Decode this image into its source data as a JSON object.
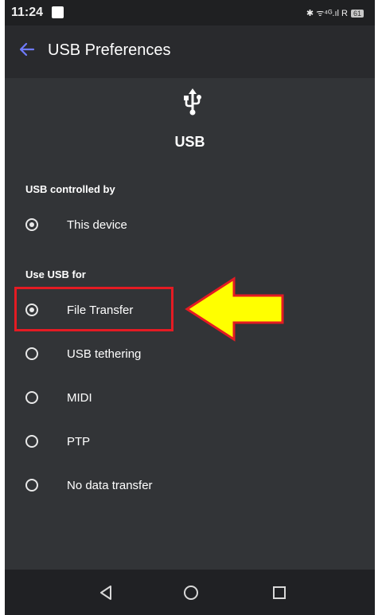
{
  "status_bar": {
    "time": "11:24",
    "indicators": "✱ ᯤ⁴ᴳ.ıl R",
    "battery": "61"
  },
  "app_bar": {
    "back_icon": "arrow-left-icon",
    "title": "USB Preferences"
  },
  "header": {
    "icon": "usb-icon",
    "label": "USB"
  },
  "sections": {
    "controlled_by": {
      "title": "USB controlled by",
      "options": [
        {
          "label": "This device",
          "selected": true
        }
      ]
    },
    "use_for": {
      "title": "Use USB for",
      "options": [
        {
          "label": "File Transfer",
          "selected": true
        },
        {
          "label": "USB tethering",
          "selected": false
        },
        {
          "label": "MIDI",
          "selected": false
        },
        {
          "label": "PTP",
          "selected": false
        },
        {
          "label": "No data transfer",
          "selected": false
        }
      ]
    }
  },
  "annotation": {
    "highlight_color": "#e41b23",
    "arrow_fill": "#ffff00",
    "arrow_stroke": "#e41b23"
  },
  "nav_bar": {
    "buttons": [
      "back-triangle-icon",
      "home-circle-icon",
      "recents-square-icon"
    ]
  },
  "colors": {
    "app_background": "#323437",
    "app_bar": "#292a2d",
    "accent": "#6f7bff"
  }
}
